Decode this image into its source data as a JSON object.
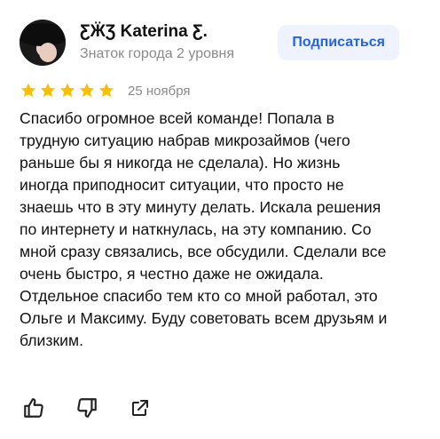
{
  "author": {
    "name": "ƸӜƷ Katerina Ƹ.",
    "status": "Знаток города 2 уровня",
    "avatar_icon": "avatar-woman-in-black-hat"
  },
  "subscribe_label": "Подписаться",
  "rating": {
    "stars": 5,
    "max": 5,
    "color": "#fcbf00"
  },
  "date": "25 ноября",
  "review_text": "Спасибо огромное всей команде! Попала в трудную ситуацию набрав микрозаймов (чего раньше бы я никогда не сделала). Но жизнь иногда приподносит ситуации, что просто не знаешь что в эту минуту делать. Искала решения по интернету и наткнулась, на эту компанию. Со мной сразу связались, все обсудили. Сделали все очень быстро, я честно даже не ожидала. Отдельное спасибо тем кто со мной работал, это Ольге и Максиму. Буду советовать всем друзьям и близким.",
  "actions": [
    {
      "icon": "thumbs-up-icon"
    },
    {
      "icon": "thumbs-down-icon"
    },
    {
      "icon": "share-icon"
    }
  ],
  "colors": {
    "accent": "#2463eb",
    "subscribe_bg": "#eef3ff",
    "muted_text": "#8a8a8a"
  }
}
